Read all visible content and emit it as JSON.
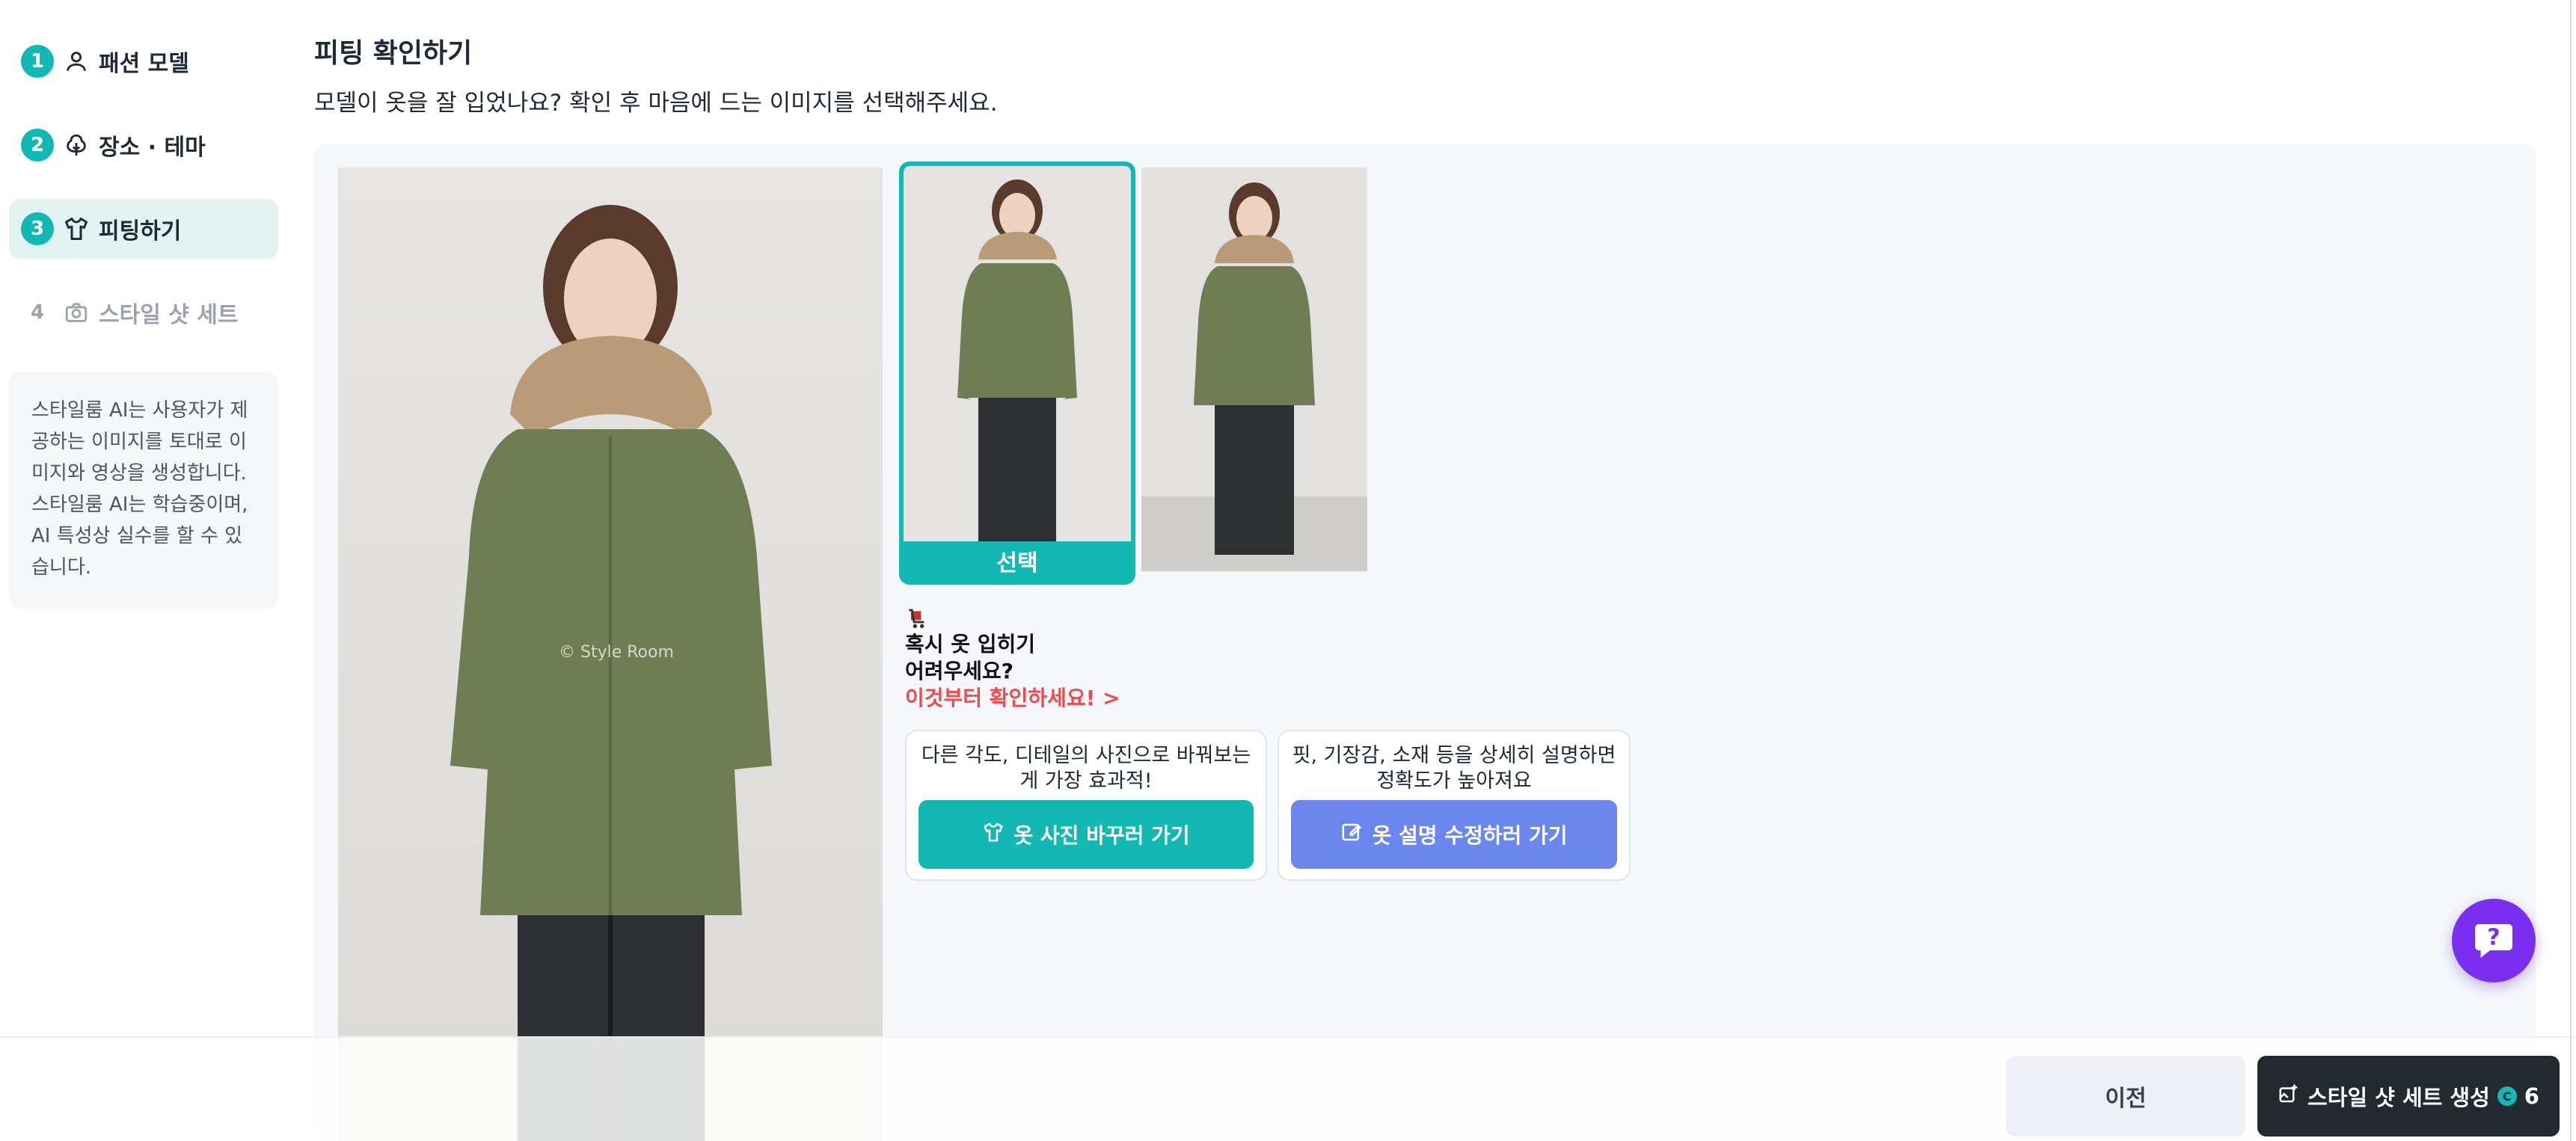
{
  "sidebar": {
    "steps": [
      {
        "num": "1",
        "label": "패션 모델",
        "icon": "person-icon"
      },
      {
        "num": "2",
        "label": "장소 · 테마",
        "icon": "tree-icon"
      },
      {
        "num": "3",
        "label": "피팅하기",
        "icon": "shirt-icon"
      },
      {
        "num": "4",
        "label": "스타일 샷 세트",
        "icon": "camera-icon"
      }
    ],
    "notice": "스타일룸 AI는 사용자가 제공하는 이미지를 토대로 이미지와 영상을 생성합니다. 스타일룸 AI는 학습중이며, AI 특성상 실수를 할 수 있습니다."
  },
  "header": {
    "title": "피팅 확인하기",
    "description": "모델이 옷을 잘 입었나요? 확인 후 마음에 드는 이미지를 선택해주세요."
  },
  "main_image": {
    "watermark": "© Style Room"
  },
  "thumbnails": {
    "selected_label": "선택"
  },
  "help": {
    "line1": "혹시 옷 입히기",
    "line2": "어려우세요?",
    "link": "이것부터 확인하세요! >"
  },
  "cards": [
    {
      "text": "다른 각도, 디테일의 사진으로 바꿔보는게 가장 효과적!",
      "button": "옷 사진 바꾸러 가기",
      "icon": "shirt-icon"
    },
    {
      "text": "핏, 기장감, 소재 등을 상세히 설명하면 정확도가 높아져요",
      "button": "옷 설명 수정하러 가기",
      "icon": "edit-icon"
    }
  ],
  "footer": {
    "prev_label": "이전",
    "generate_label": "스타일 샷 세트 생성",
    "credit_symbol": "C",
    "credit_count": "6"
  },
  "colors": {
    "accent": "#12b8b4",
    "secondary": "#6c86f0",
    "dark": "#23292f",
    "help": "#ef4a4a",
    "fab": "#7a2ff0"
  }
}
